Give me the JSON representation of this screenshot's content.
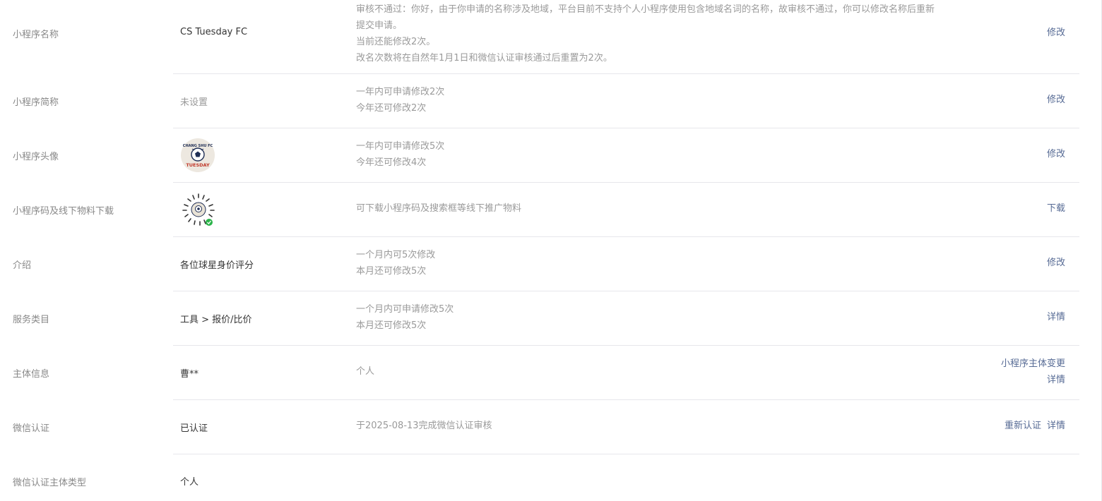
{
  "rows": [
    {
      "label": "小程序名称",
      "value": "CS Tuesday FC",
      "desc": [
        "审核不通过：你好，由于你申请的名称涉及地域，平台目前不支持个人小程序使用包含地域名词的名称，故审核不通过，你可以修改名称后重新",
        "提交申请。",
        "当前还能修改2次。",
        "改名次数将在自然年1月1日和微信认证审核通过后重置为2次。"
      ],
      "actions": [
        "修改"
      ]
    },
    {
      "label": "小程序简称",
      "value": "未设置",
      "desc": [
        "一年内可申请修改2次",
        "今年还可修改2次"
      ],
      "actions": [
        "修改"
      ]
    },
    {
      "label": "小程序头像",
      "avatar": {
        "top_text": "CHANG SHU FC",
        "bottom_text": "TUESDAY",
        "bg_color": "#ede8e0",
        "ring_color": "#1f2e55",
        "accent_color": "#c0392b"
      },
      "desc": [
        "一年内可申请修改5次",
        "今年还可修改4次"
      ],
      "actions": [
        "修改"
      ]
    },
    {
      "label": "小程序码及线下物料下载",
      "qrcode": {
        "badge_color": "#2bb44a"
      },
      "desc": [
        "可下载小程序码及搜索框等线下推广物料"
      ],
      "actions": [
        "下载"
      ]
    },
    {
      "label": "介绍",
      "value": "各位球星身价评分",
      "desc": [
        "一个月内可5次修改",
        "本月还可修改5次"
      ],
      "actions": [
        "修改"
      ]
    },
    {
      "label": "服务类目",
      "value": "工具 > 报价/比价",
      "desc": [
        "一个月内可申请修改5次",
        "本月还可修改5次"
      ],
      "actions": [
        "详情"
      ]
    },
    {
      "label": "主体信息",
      "value": "曹**",
      "desc": [
        "个人"
      ],
      "actions": [
        "小程序主体变更",
        "详情"
      ]
    },
    {
      "label": "微信认证",
      "value": "已认证",
      "desc": [
        "于2025-08-13完成微信认证审核"
      ],
      "actions": [
        "重新认证",
        "详情"
      ]
    },
    {
      "label": "微信认证主体类型",
      "value": "个人"
    }
  ],
  "colors": {
    "link": "#576b95",
    "label": "#888888",
    "value": "#353535",
    "desc": "#9a9a9a",
    "divider": "#e7e7eb"
  }
}
